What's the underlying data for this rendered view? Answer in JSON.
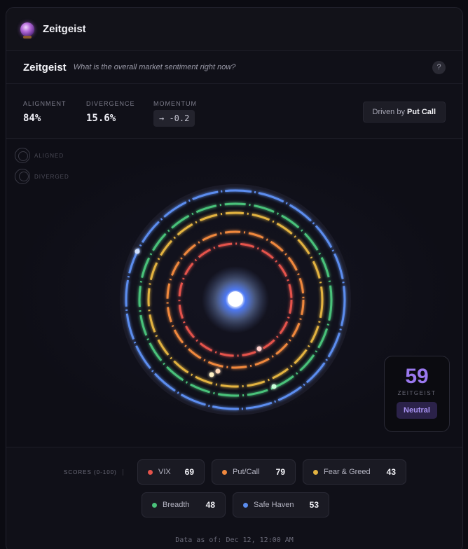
{
  "app": {
    "title": "Zeitgeist",
    "logo_icon": "crystal-ball-icon"
  },
  "widget": {
    "title": "Zeitgeist",
    "question": "What is the overall market sentiment right now?",
    "help": "?"
  },
  "metrics": {
    "alignment": {
      "label": "ALIGNMENT",
      "value": "84%"
    },
    "divergence": {
      "label": "DIVERGENCE",
      "value": "15.6%"
    },
    "momentum": {
      "label": "MOMENTUM",
      "value": "→ -0.2"
    },
    "driven_prefix": "Driven by",
    "driven_by": "Put Call"
  },
  "viz_legend": {
    "aligned": "ALIGNED",
    "diverged": "DIVERGED"
  },
  "score": {
    "value": "59",
    "label": "ZEITGEIST",
    "state": "Neutral"
  },
  "scores": {
    "label": "SCORES (0-100)",
    "items": [
      {
        "name": "VIX",
        "value": "69",
        "color": "#e5534b"
      },
      {
        "name": "Put/Call",
        "value": "79",
        "color": "#f0883e"
      },
      {
        "name": "Fear & Greed",
        "value": "43",
        "color": "#e3b341"
      },
      {
        "name": "Breadth",
        "value": "48",
        "color": "#4ac27a"
      },
      {
        "name": "Safe Haven",
        "value": "53",
        "color": "#5b8def"
      }
    ]
  },
  "footer": "Data as of: Dec 12, 12:00 AM"
}
